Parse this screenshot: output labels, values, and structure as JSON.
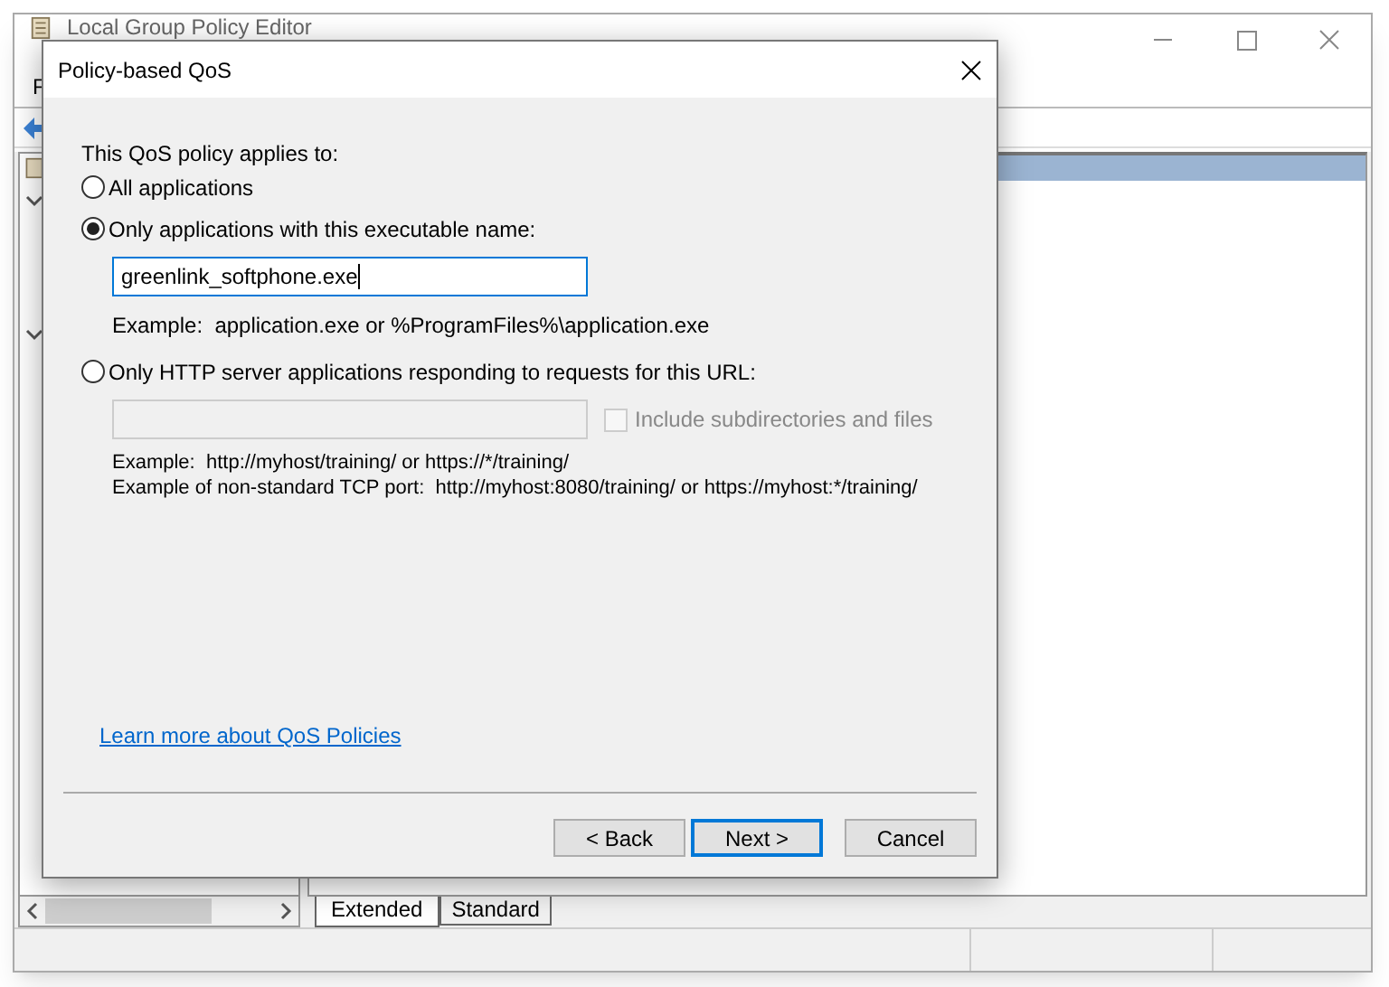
{
  "background_window": {
    "title": "Local Group Policy Editor",
    "menu": [
      "F"
    ],
    "tabs": [
      {
        "label": "Extended",
        "selected": true
      },
      {
        "label": "Standard",
        "selected": false
      }
    ]
  },
  "dialog": {
    "title": "Policy-based QoS",
    "prompt": "This QoS policy applies to:",
    "options": [
      {
        "label": "All applications",
        "selected": false
      },
      {
        "label": "Only applications with this executable name:",
        "selected": true
      },
      {
        "label": "Only HTTP server applications responding to requests for this URL:",
        "selected": false
      }
    ],
    "executable": {
      "value": "greenlink_softphone.exe",
      "example": "Example:  application.exe or %ProgramFiles%\\application.exe"
    },
    "url": {
      "disabled": true,
      "include_subdirectories": {
        "label": "Include subdirectories and files",
        "checked": false,
        "disabled": true
      },
      "examples": [
        "Example:  http://myhost/training/ or https://*/training/",
        "Example of non-standard TCP port:  http://myhost:8080/training/ or https://myhost:*/training/"
      ]
    },
    "link": "Learn more about QoS Policies",
    "buttons": [
      {
        "label": "< Back",
        "focused": false
      },
      {
        "label": "Next >",
        "focused": true
      },
      {
        "label": "Cancel",
        "focused": false
      }
    ]
  }
}
